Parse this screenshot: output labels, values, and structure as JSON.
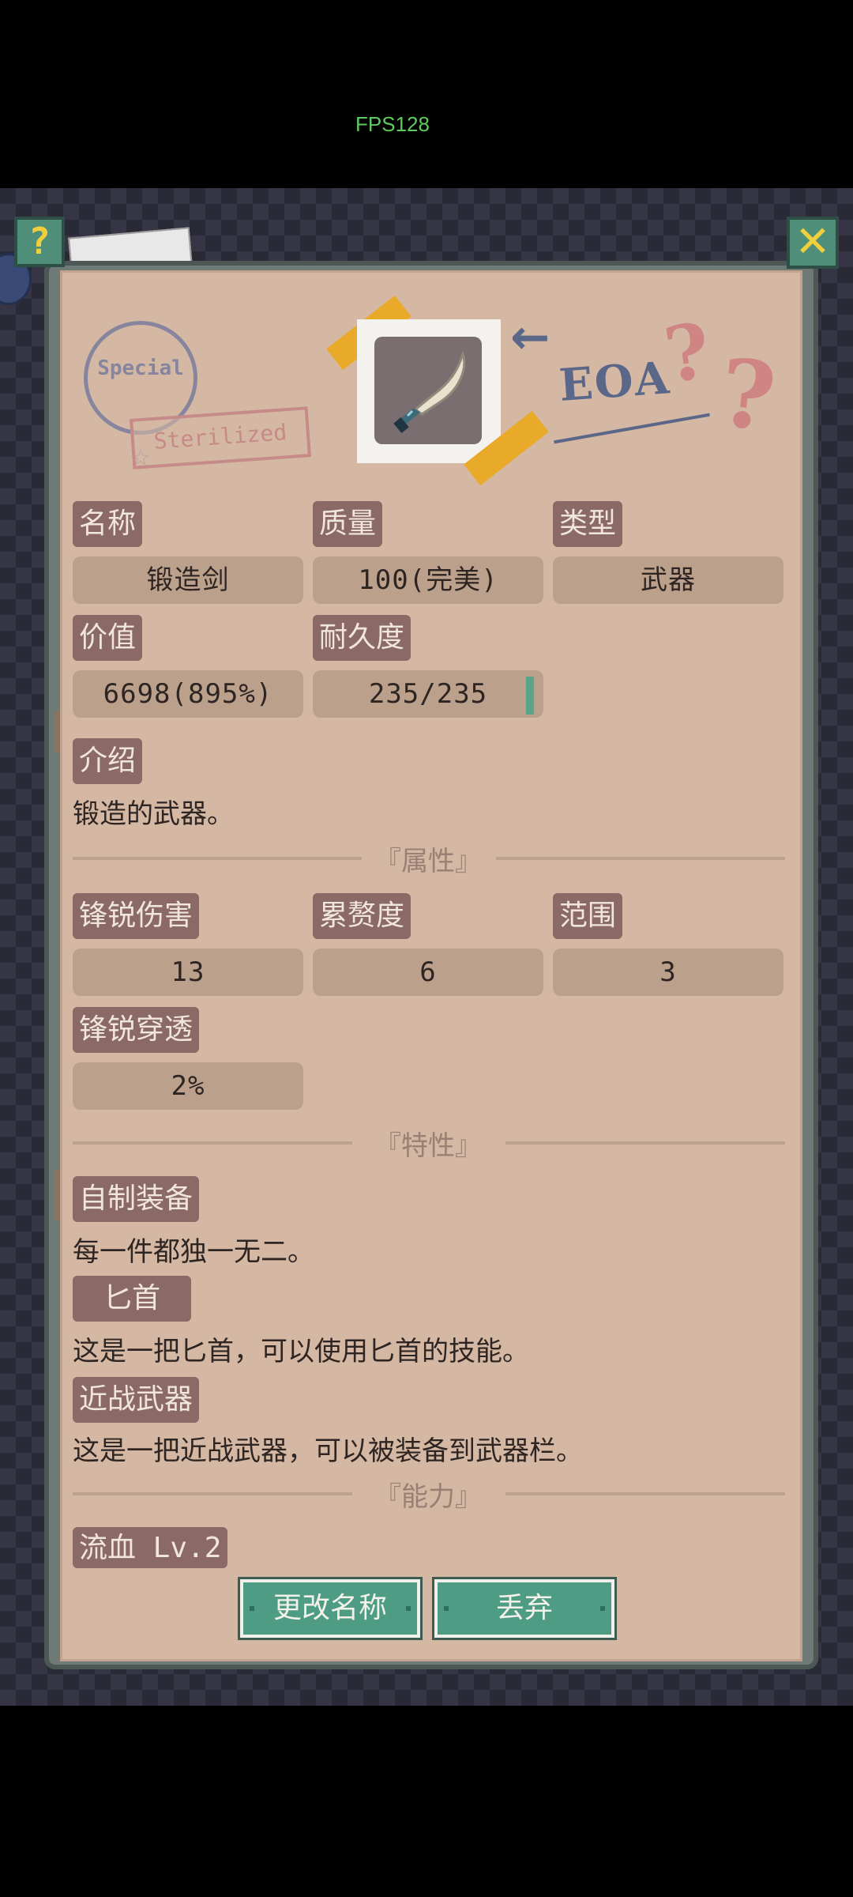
{
  "status": {
    "fps": "FPS128"
  },
  "window": {
    "help_glyph": "?",
    "close_glyph": "✕"
  },
  "decor": {
    "stamp_text": "Special",
    "stamp_star": "☆",
    "sterilized_text": "Sterilized",
    "arrow_glyph": "←",
    "eoa_text": "EOA",
    "question_glyph": "?"
  },
  "item": {
    "name_label": "名称",
    "name_value": "锻造剑",
    "quality_label": "质量",
    "quality_value": "100(完美)",
    "type_label": "类型",
    "type_value": "武器",
    "price_label": "价值",
    "price_value": "6698(895%)",
    "durability_label": "耐久度",
    "durability_value": "235/235",
    "durability_fraction": 1.0,
    "intro_label": "介绍",
    "intro_text": "锻造的武器。"
  },
  "attributes": {
    "section_title": "『属性』",
    "sharp_damage_label": "锋锐伤害",
    "sharp_damage_value": "13",
    "burden_label": "累赘度",
    "burden_value": "6",
    "range_label": "范围",
    "range_value": "3",
    "sharp_pierce_label": "锋锐穿透",
    "sharp_pierce_value": "2%"
  },
  "traits": {
    "section_title": "『特性』",
    "items": [
      {
        "label": "自制装备",
        "desc": "每一件都独一无二。"
      },
      {
        "label": "匕首",
        "desc": "这是一把匕首，可以使用匕首的技能。"
      },
      {
        "label": "近战武器",
        "desc": "这是一把近战武器，可以被装备到武器栏。"
      }
    ]
  },
  "abilities": {
    "section_title": "『能力』",
    "items": [
      {
        "label": "流血 Lv.2"
      }
    ]
  },
  "actions": {
    "rename_label": "更改名称",
    "discard_label": "丢弃"
  },
  "colors": {
    "paper": "#d4b8a3",
    "tag_bg": "#8b6a65",
    "value_bg": "#bba18c",
    "button_green": "#4e9c84",
    "fps_green": "#5ecb5e"
  }
}
